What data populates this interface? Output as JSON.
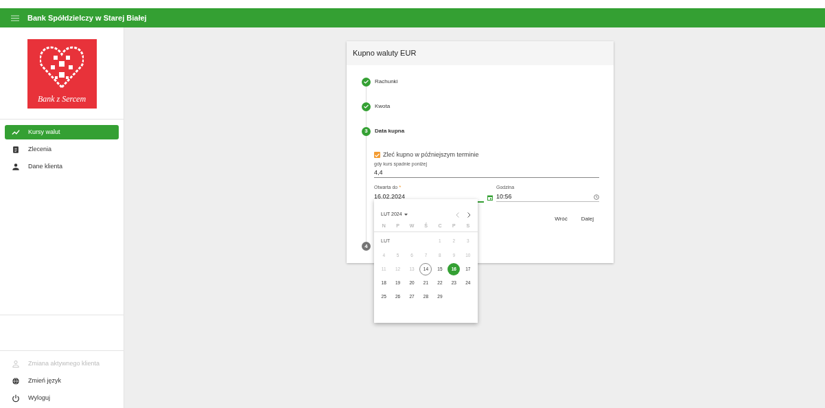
{
  "header": {
    "title": "Bank Spółdzielczy w Starej Białej"
  },
  "logo": {
    "caption": "Bank z Sercem"
  },
  "nav": [
    {
      "label": "Kursy walut",
      "selected": true
    },
    {
      "label": "Zlecenia",
      "selected": false
    },
    {
      "label": "Dane klienta",
      "selected": false
    }
  ],
  "bottom_nav": [
    {
      "label": "Zmiana aktywnego klienta",
      "disabled": true
    },
    {
      "label": "Zmień język",
      "disabled": false
    },
    {
      "label": "Wyloguj",
      "disabled": false
    }
  ],
  "card": {
    "title": "Kupno waluty EUR",
    "steps": [
      {
        "label": "Rachunki",
        "kind": "done"
      },
      {
        "label": "Kwota",
        "kind": "done"
      },
      {
        "marker": "3",
        "label": "Data kupna",
        "kind": "active"
      },
      {
        "marker": "4",
        "kind": "pending"
      }
    ],
    "checkbox": {
      "label": "Zleć kupno w późniejszym terminie",
      "checked": true
    },
    "rate_field": {
      "label": "gdy kurs spadnie poniżej",
      "value": "4,4"
    },
    "date_field": {
      "label": "Otwarta do",
      "required_mark": "*",
      "value": "16.02.2024"
    },
    "time_field": {
      "label": "Godzina",
      "value": "10:56"
    },
    "buttons": [
      "Wróć",
      "Dalej"
    ]
  },
  "calendar": {
    "period": "LUT 2024",
    "month_label": "LUT",
    "weekdays": [
      "N",
      "P",
      "W",
      "Ś",
      "C",
      "P",
      "S"
    ],
    "weeks": [
      [
        {
          "day": "1",
          "disabled": true,
          "today": false,
          "selected": false
        },
        {
          "day": "2",
          "disabled": true,
          "today": false,
          "selected": false
        },
        {
          "day": "3",
          "disabled": true,
          "today": false,
          "selected": false
        }
      ],
      [
        {
          "day": "4",
          "disabled": true,
          "today": false,
          "selected": false
        },
        {
          "day": "5",
          "disabled": true,
          "today": false,
          "selected": false
        },
        {
          "day": "6",
          "disabled": true,
          "today": false,
          "selected": false
        },
        {
          "day": "7",
          "disabled": true,
          "today": false,
          "selected": false
        },
        {
          "day": "8",
          "disabled": true,
          "today": false,
          "selected": false
        },
        {
          "day": "9",
          "disabled": true,
          "today": false,
          "selected": false
        },
        {
          "day": "10",
          "disabled": true,
          "today": false,
          "selected": false
        }
      ],
      [
        {
          "day": "11",
          "disabled": true,
          "today": false,
          "selected": false
        },
        {
          "day": "12",
          "disabled": true,
          "today": false,
          "selected": false
        },
        {
          "day": "13",
          "disabled": true,
          "today": false,
          "selected": false
        },
        {
          "day": "14",
          "disabled": false,
          "today": true,
          "selected": false
        },
        {
          "day": "15",
          "disabled": false,
          "today": false,
          "selected": false
        },
        {
          "day": "16",
          "disabled": false,
          "today": false,
          "selected": true
        },
        {
          "day": "17",
          "disabled": false,
          "today": false,
          "selected": false
        }
      ],
      [
        {
          "day": "18",
          "disabled": false,
          "today": false,
          "selected": false
        },
        {
          "day": "19",
          "disabled": false,
          "today": false,
          "selected": false
        },
        {
          "day": "20",
          "disabled": false,
          "today": false,
          "selected": false
        },
        {
          "day": "21",
          "disabled": false,
          "today": false,
          "selected": false
        },
        {
          "day": "22",
          "disabled": false,
          "today": false,
          "selected": false
        },
        {
          "day": "23",
          "disabled": false,
          "today": false,
          "selected": false
        },
        {
          "day": "24",
          "disabled": false,
          "today": false,
          "selected": false
        }
      ],
      [
        {
          "day": "25",
          "disabled": false,
          "today": false,
          "selected": false
        },
        {
          "day": "26",
          "disabled": false,
          "today": false,
          "selected": false
        },
        {
          "day": "27",
          "disabled": false,
          "today": false,
          "selected": false
        },
        {
          "day": "28",
          "disabled": false,
          "today": false,
          "selected": false
        },
        {
          "day": "29",
          "disabled": false,
          "today": false,
          "selected": false
        }
      ]
    ]
  }
}
